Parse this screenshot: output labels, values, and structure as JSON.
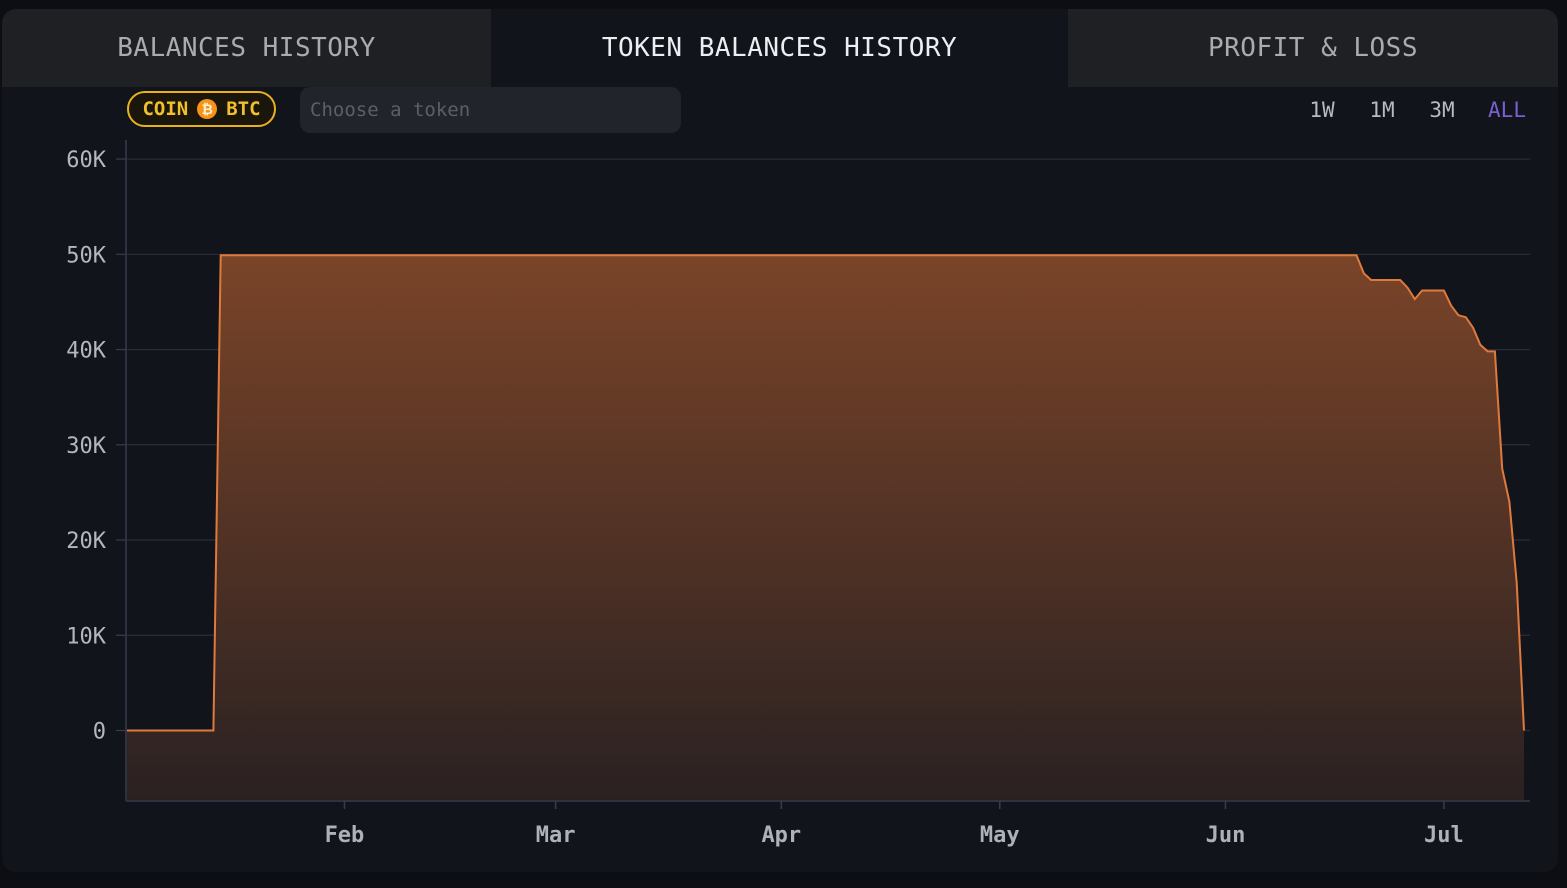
{
  "tabs": [
    {
      "label": "BALANCES HISTORY",
      "active": false
    },
    {
      "label": "TOKEN BALANCES HISTORY",
      "active": true
    },
    {
      "label": "PROFIT & LOSS",
      "active": false
    }
  ],
  "coin_badge": {
    "type_label": "COIN",
    "symbol": "BTC",
    "icon": "bitcoin-icon",
    "icon_glyph": "₿"
  },
  "token_search": {
    "placeholder": "Choose a token",
    "value": ""
  },
  "time_ranges": [
    {
      "label": "1W",
      "selected": false
    },
    {
      "label": "1M",
      "selected": false
    },
    {
      "label": "3M",
      "selected": false
    },
    {
      "label": "ALL",
      "selected": true
    }
  ],
  "colors": {
    "line": "#e07a3c",
    "fill_top": "#7a4428",
    "fill_bottom": "#2a2122",
    "accent_selected": "#7a5fd0",
    "badge": "#e9b21d"
  },
  "chart_data": {
    "type": "area",
    "title": "",
    "xlabel": "",
    "ylabel": "",
    "x_axis": "date",
    "x_ticks": [
      {
        "date": "2024-02-01",
        "label": "Feb"
      },
      {
        "date": "2024-03-01",
        "label": "Mar"
      },
      {
        "date": "2024-04-01",
        "label": "Apr"
      },
      {
        "date": "2024-05-01",
        "label": "May"
      },
      {
        "date": "2024-06-01",
        "label": "Jun"
      },
      {
        "date": "2024-07-01",
        "label": "Jul"
      }
    ],
    "y_ticks": [
      {
        "value": 0,
        "label": "0"
      },
      {
        "value": 10000,
        "label": "10K"
      },
      {
        "value": 20000,
        "label": "20K"
      },
      {
        "value": 30000,
        "label": "30K"
      },
      {
        "value": 40000,
        "label": "40K"
      },
      {
        "value": 50000,
        "label": "50K"
      },
      {
        "value": 60000,
        "label": "60K"
      }
    ],
    "xlim": [
      "2024-01-02",
      "2024-07-12"
    ],
    "ylim": [
      -7400,
      62000
    ],
    "grid": true,
    "series": [
      {
        "points": [
          {
            "x": "2024-01-02",
            "y": 0
          },
          {
            "x": "2024-01-14",
            "y": 0
          },
          {
            "x": "2024-01-15",
            "y": 49900
          },
          {
            "x": "2024-06-19",
            "y": 49900
          },
          {
            "x": "2024-06-20",
            "y": 48000
          },
          {
            "x": "2024-06-21",
            "y": 47300
          },
          {
            "x": "2024-06-25",
            "y": 47300
          },
          {
            "x": "2024-06-26",
            "y": 46500
          },
          {
            "x": "2024-06-27",
            "y": 45300
          },
          {
            "x": "2024-06-28",
            "y": 46200
          },
          {
            "x": "2024-07-01",
            "y": 46200
          },
          {
            "x": "2024-07-02",
            "y": 44600
          },
          {
            "x": "2024-07-03",
            "y": 43600
          },
          {
            "x": "2024-07-04",
            "y": 43400
          },
          {
            "x": "2024-07-05",
            "y": 42300
          },
          {
            "x": "2024-07-06",
            "y": 40500
          },
          {
            "x": "2024-07-07",
            "y": 39800
          },
          {
            "x": "2024-07-08",
            "y": 39800
          },
          {
            "x": "2024-07-09",
            "y": 27500
          },
          {
            "x": "2024-07-10",
            "y": 24000
          },
          {
            "x": "2024-07-11",
            "y": 15500
          },
          {
            "x": "2024-07-12",
            "y": 0
          }
        ]
      }
    ]
  }
}
